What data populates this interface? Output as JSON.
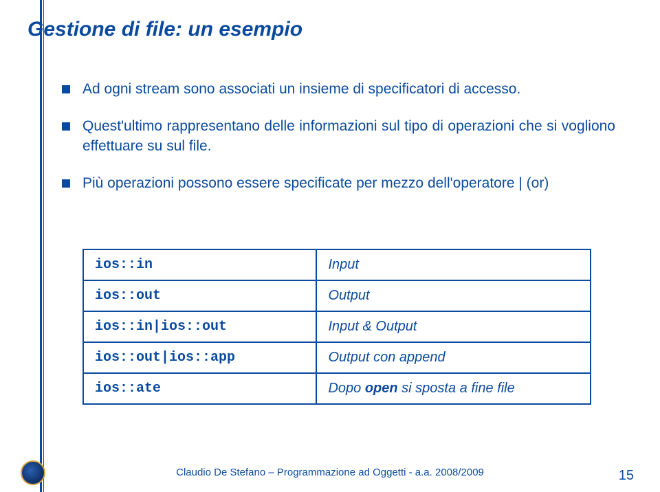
{
  "title": "Gestione di file: un esempio",
  "bullets": {
    "b0": "Ad ogni stream sono associati un insieme di specificatori di accesso.",
    "b1": "Quest'ultimo rappresentano delle informazioni sul tipo di operazioni che si vogliono effettuare su sul file.",
    "b2": "Più operazioni possono essere specificate per mezzo dell'operatore | (or)"
  },
  "table": {
    "rows": [
      {
        "mode": "ios::in",
        "desc_pre": "Input",
        "desc_bold": "",
        "desc_post": ""
      },
      {
        "mode": "ios::out",
        "desc_pre": "Output",
        "desc_bold": "",
        "desc_post": ""
      },
      {
        "mode": "ios::in|ios::out",
        "desc_pre": "Input & Output",
        "desc_bold": "",
        "desc_post": ""
      },
      {
        "mode": "ios::out|ios::app",
        "desc_pre": "Output con append",
        "desc_bold": "",
        "desc_post": ""
      },
      {
        "mode": "ios::ate",
        "desc_pre": "Dopo ",
        "desc_bold": "open",
        "desc_post": " si sposta a fine file"
      }
    ]
  },
  "footer": {
    "text": "Claudio De Stefano – Programmazione ad Oggetti - a.a. 2008/2009",
    "pagenum": "15"
  }
}
